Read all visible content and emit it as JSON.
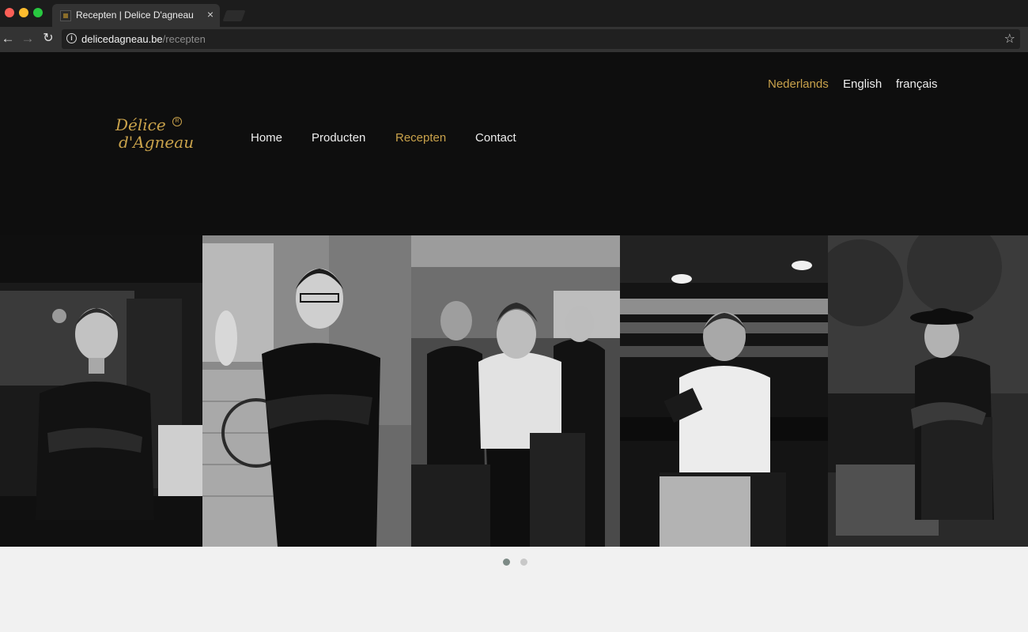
{
  "browser": {
    "tab_title": "Recepten | Delice D'agneau",
    "close_glyph": "×",
    "url_host": "delicedagneau.be",
    "url_path": "/recepten",
    "back_glyph": "←",
    "forward_glyph": "→",
    "reload_glyph": "↻",
    "info_glyph": "i",
    "star_glyph": "☆",
    "icons": [
      "back-arrow-icon",
      "forward-arrow-icon",
      "reload-icon",
      "info-icon",
      "star-icon",
      "close-icon"
    ]
  },
  "languages": [
    {
      "label": "Nederlands",
      "active": true
    },
    {
      "label": "English",
      "active": false
    },
    {
      "label": "français",
      "active": false
    }
  ],
  "logo": {
    "line1": "Délice",
    "line2": "d'Agneau",
    "reg": "R"
  },
  "nav": [
    {
      "label": "Home",
      "active": false
    },
    {
      "label": "Producten",
      "active": false
    },
    {
      "label": "Recepten",
      "active": true
    },
    {
      "label": "Contact",
      "active": false
    }
  ],
  "slider": {
    "slides": [
      "chef-portrait-1",
      "chef-portrait-2",
      "chef-group-portrait",
      "chef-portrait-4",
      "chef-portrait-5"
    ],
    "dots": 2,
    "active_dot": 1
  },
  "colors": {
    "accent": "#c9a24b",
    "header_bg": "#0e0e0e",
    "page_bg": "#f1f1f1",
    "nav_text": "#ededed"
  }
}
